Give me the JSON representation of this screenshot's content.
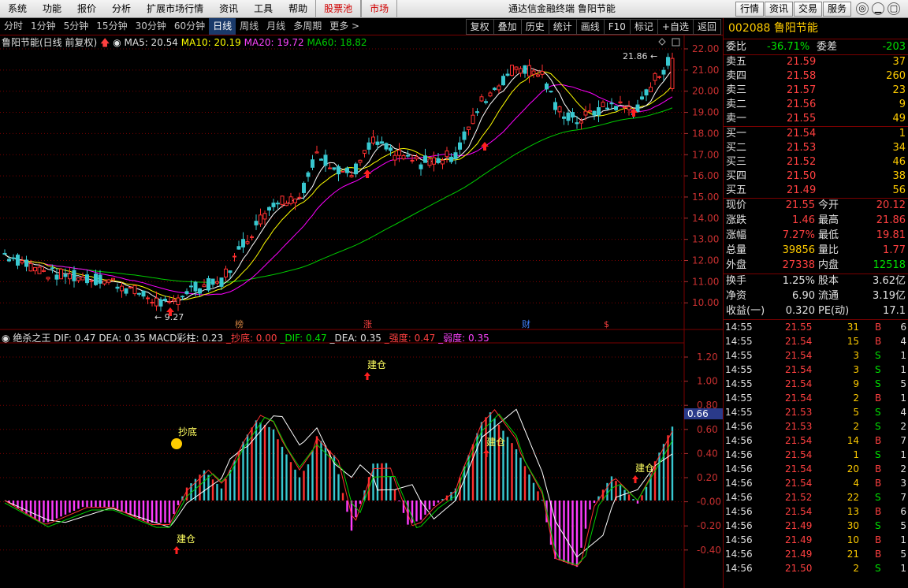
{
  "menu": {
    "items": [
      "系统",
      "功能",
      "报价",
      "分析",
      "扩展市场行情",
      "资讯",
      "工具",
      "帮助",
      "股票池",
      "市场"
    ],
    "app_title": "通达信金融终端 鲁阳节能",
    "right_buttons": [
      "行情",
      "资讯",
      "交易",
      "服务"
    ],
    "win_buttons": [
      "◎",
      "▁",
      "▢",
      "✕"
    ]
  },
  "period": {
    "items": [
      "分时",
      "1分钟",
      "5分钟",
      "15分钟",
      "30分钟",
      "60分钟",
      "日线",
      "周线",
      "月线",
      "多周期",
      "更多 >"
    ],
    "active": "日线",
    "tools": [
      "复权",
      "叠加",
      "历史",
      "统计",
      "画线",
      "F10",
      "标记",
      "+自选",
      "返回"
    ]
  },
  "ma_line": {
    "name": "鲁阳节能(日线 前复权)",
    "ma5": "MA5: 20.54",
    "ma10": "MA10: 20.19",
    "ma20": "MA20: 19.72",
    "ma60": "MA60: 18.82"
  },
  "colors": {
    "ma5": "#ffffff",
    "ma10": "#ffff00",
    "ma20": "#ff00ff",
    "ma60": "#00cc00",
    "up": "#ff3030",
    "down": "#38c8d0",
    "grid": "#7a0000"
  },
  "price_axis": {
    "labels": [
      "22.00",
      "21.00",
      "20.00",
      "19.00",
      "18.00",
      "17.00",
      "16.00",
      "15.00",
      "14.00",
      "13.00",
      "12.00",
      "11.00",
      "10.00"
    ],
    "high_label": "21.86",
    "low_label": "9.27"
  },
  "events": [
    "榜",
    "涨",
    "财",
    "$"
  ],
  "macd_line": {
    "indicator": "绝杀之王",
    "dif": "DIF: 0.47",
    "dea": "DEA: 0.35",
    "macd": "MACD彩柱: 0.23",
    "chaodi": "_抄底: 0.00",
    "dif2": "_DIF: 0.47",
    "dea2": "_DEA: 0.35",
    "qiang": "_强度: 0.47",
    "ruo": "_弱度: 0.35"
  },
  "macd_axis": {
    "labels": [
      "1.20",
      "1.00",
      "0.80",
      "0.60",
      "0.40",
      "0.20",
      "-0.00",
      "-0.20",
      "-0.40"
    ],
    "current": "0.66"
  },
  "signals": {
    "chaodi": "抄底",
    "jiancang": "建仓"
  },
  "stock": {
    "code": "002088",
    "name": "鲁阳节能"
  },
  "order_ratio": {
    "label1": "委比",
    "value1": "-36.71%",
    "label2": "委差",
    "value2": "-203"
  },
  "sell": [
    {
      "label": "卖五",
      "price": "21.59",
      "vol": "37"
    },
    {
      "label": "卖四",
      "price": "21.58",
      "vol": "260"
    },
    {
      "label": "卖三",
      "price": "21.57",
      "vol": "23"
    },
    {
      "label": "卖二",
      "price": "21.56",
      "vol": "9"
    },
    {
      "label": "卖一",
      "price": "21.55",
      "vol": "49"
    }
  ],
  "buy": [
    {
      "label": "买一",
      "price": "21.54",
      "vol": "1"
    },
    {
      "label": "买二",
      "price": "21.53",
      "vol": "34"
    },
    {
      "label": "买三",
      "price": "21.52",
      "vol": "46"
    },
    {
      "label": "买四",
      "price": "21.50",
      "vol": "38"
    },
    {
      "label": "买五",
      "price": "21.49",
      "vol": "56"
    }
  ],
  "stats": [
    {
      "l1": "现价",
      "v1": "21.55",
      "c1": "r",
      "l2": "今开",
      "v2": "20.12",
      "c2": "r"
    },
    {
      "l1": "涨跌",
      "v1": "1.46",
      "c1": "r",
      "l2": "最高",
      "v2": "21.86",
      "c2": "r"
    },
    {
      "l1": "涨幅",
      "v1": "7.27%",
      "c1": "r",
      "l2": "最低",
      "v2": "19.81",
      "c2": "r"
    },
    {
      "l1": "总量",
      "v1": "39856",
      "c1": "g",
      "l2": "量比",
      "v2": "1.77",
      "c2": "r"
    },
    {
      "l1": "外盘",
      "v1": "27338",
      "c1": "r",
      "l2": "内盘",
      "v2": "12518",
      "c2": "gr"
    }
  ],
  "stats2": [
    {
      "l1": "换手",
      "v1": "1.25%",
      "l2": "股本",
      "v2": "3.62亿"
    },
    {
      "l1": "净资",
      "v1": "6.90",
      "l2": "流通",
      "v2": "3.19亿"
    },
    {
      "l1": "收益(一)",
      "v1": "0.320",
      "l2": "PE(动)",
      "v2": "17.1"
    }
  ],
  "ticks": [
    {
      "t": "14:55",
      "p": "21.55",
      "v": "31",
      "d": "B",
      "n": "6"
    },
    {
      "t": "14:55",
      "p": "21.54",
      "v": "15",
      "d": "B",
      "n": "4"
    },
    {
      "t": "14:55",
      "p": "21.54",
      "v": "3",
      "d": "S",
      "n": "1"
    },
    {
      "t": "14:55",
      "p": "21.54",
      "v": "3",
      "d": "S",
      "n": "1"
    },
    {
      "t": "14:55",
      "p": "21.54",
      "v": "9",
      "d": "S",
      "n": "5"
    },
    {
      "t": "14:55",
      "p": "21.54",
      "v": "2",
      "d": "B",
      "n": "1"
    },
    {
      "t": "14:55",
      "p": "21.53",
      "v": "5",
      "d": "S",
      "n": "4"
    },
    {
      "t": "14:56",
      "p": "21.53",
      "v": "2",
      "d": "S",
      "n": "2"
    },
    {
      "t": "14:56",
      "p": "21.54",
      "v": "14",
      "d": "B",
      "n": "7"
    },
    {
      "t": "14:56",
      "p": "21.54",
      "v": "1",
      "d": "S",
      "n": "1"
    },
    {
      "t": "14:56",
      "p": "21.54",
      "v": "20",
      "d": "B",
      "n": "2"
    },
    {
      "t": "14:56",
      "p": "21.54",
      "v": "4",
      "d": "B",
      "n": "3"
    },
    {
      "t": "14:56",
      "p": "21.52",
      "v": "22",
      "d": "S",
      "n": "7"
    },
    {
      "t": "14:56",
      "p": "21.54",
      "v": "13",
      "d": "B",
      "n": "6"
    },
    {
      "t": "14:56",
      "p": "21.49",
      "v": "30",
      "d": "S",
      "n": "5"
    },
    {
      "t": "14:56",
      "p": "21.49",
      "v": "10",
      "d": "B",
      "n": "1"
    },
    {
      "t": "14:56",
      "p": "21.49",
      "v": "21",
      "d": "B",
      "n": "5"
    },
    {
      "t": "14:56",
      "p": "21.50",
      "v": "2",
      "d": "S",
      "n": "1"
    }
  ]
}
